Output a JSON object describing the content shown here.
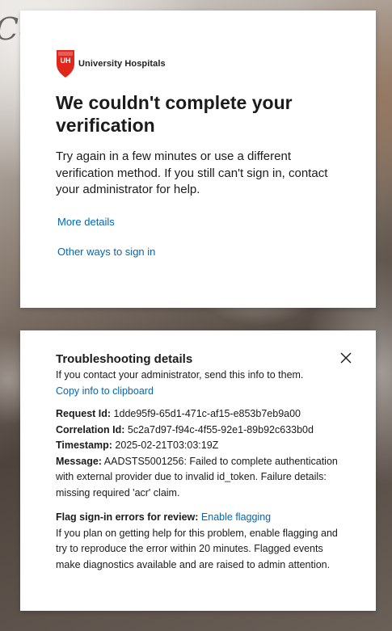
{
  "background": {
    "partial_text": "Cc"
  },
  "colors": {
    "accent": "#0067b8",
    "text": "#1b1b1b",
    "logo_red": "#e1261c"
  },
  "main": {
    "logo_text": "University Hospitals",
    "logo_mark": "UH",
    "title": "We couldn't complete your verification",
    "description": "Try again in a few minutes or use a different verification method. If you still can't sign in, contact your administrator for help.",
    "more_details_label": "More details",
    "other_ways_label": "Other ways to sign in"
  },
  "details": {
    "heading": "Troubleshooting details",
    "subtext": "If you contact your administrator, send this info to them.",
    "copy_label": "Copy info to clipboard",
    "close_icon": "close-icon",
    "request_id_label": "Request Id:",
    "request_id": "1dde95f9-65d1-471c-af15-e853b7eb9a00",
    "correlation_id_label": "Correlation Id:",
    "correlation_id": "5c2a7d97-f94c-4f55-92e1-89b92c633b0d",
    "timestamp_label": "Timestamp:",
    "timestamp": "2025-02-21T03:03:19Z",
    "message_label": "Message:",
    "message": "AADSTS5001256: Failed to complete authentication with external provider due to invalid id_token. Failure details: missing required 'acr' claim.",
    "flag_label": "Flag sign-in errors for review:",
    "flag_link": "Enable flagging",
    "flag_text": "If you plan on getting help for this problem, enable flagging and try to reproduce the error within 20 minutes. Flagged events make diagnostics available and are raised to admin attention."
  }
}
